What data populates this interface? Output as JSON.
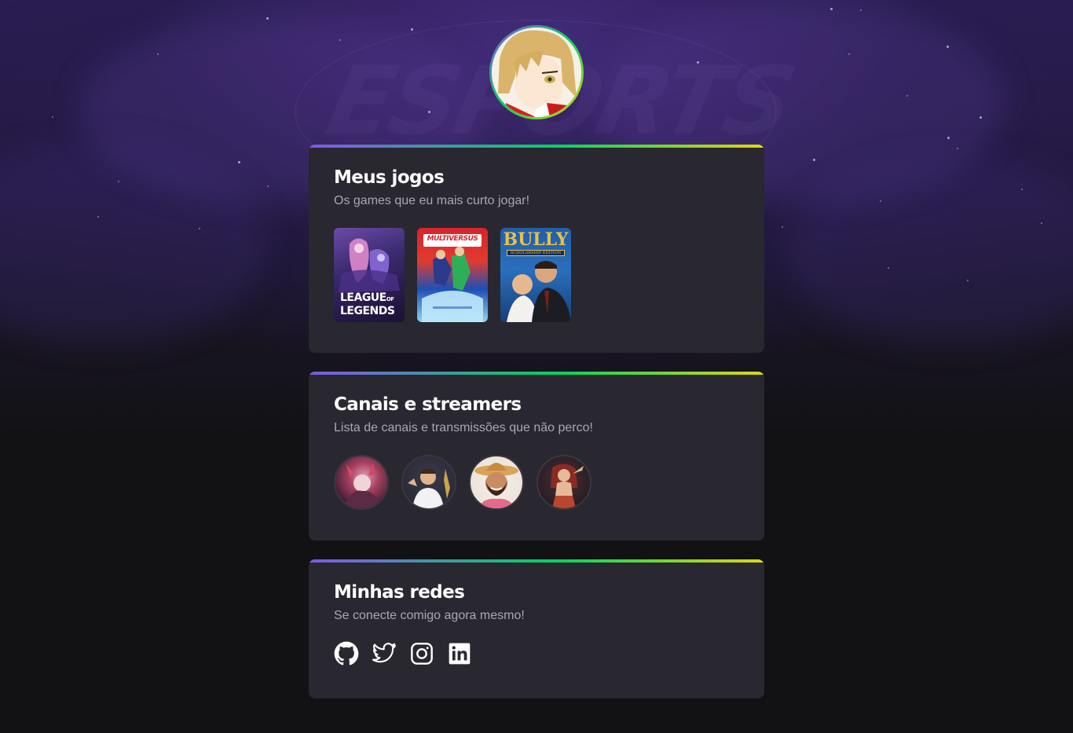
{
  "profile": {
    "avatar_icon": "anime-avatar"
  },
  "colors": {
    "accent_purple": "#8257e5",
    "accent_green": "#04d361",
    "accent_yellow": "#e1d70c",
    "card_bg": "#29272f",
    "page_bg": "#121214"
  },
  "games_section": {
    "title": "Meus jogos",
    "subtitle": "Os games que eu mais curto jogar!",
    "games": [
      {
        "name": "League of Legends",
        "cover_line1": "LEAGUE",
        "cover_of": "OF",
        "cover_line2": "LEGENDS"
      },
      {
        "name": "MultiVersus",
        "cover_text": "MULTIVERSUS"
      },
      {
        "name": "Bully",
        "cover_text": "BULLY",
        "cover_sub": "SCHOLARSHIP EDITION"
      }
    ]
  },
  "streamers_section": {
    "title": "Canais e streamers",
    "subtitle": "Lista de canais e transmissões que não perco!",
    "streamers": [
      "streamer-1",
      "streamer-2",
      "streamer-3",
      "streamer-4"
    ]
  },
  "socials_section": {
    "title": "Minhas redes",
    "subtitle": "Se conecte comigo agora mesmo!",
    "links": [
      "github-icon",
      "twitter-icon",
      "instagram-icon",
      "linkedin-icon"
    ]
  }
}
